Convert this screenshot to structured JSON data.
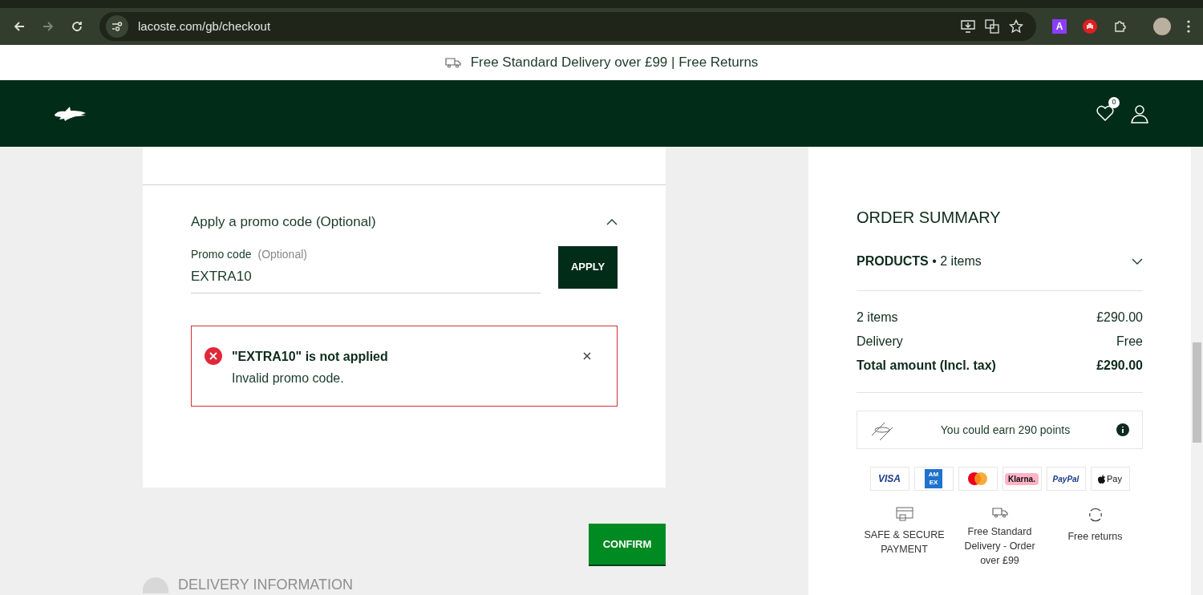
{
  "browser": {
    "url": "lacoste.com/gb/checkout",
    "extension_letter": "A"
  },
  "banner": {
    "text": "Free Standard Delivery over £99 | Free Returns"
  },
  "header": {
    "wishlist_count": "0"
  },
  "promo": {
    "title": "Apply a promo code (Optional)",
    "expanded": true,
    "label": "Promo code",
    "hint": "(Optional)",
    "value": "EXTRA10",
    "apply": "APPLY",
    "error": {
      "title": "\"EXTRA10\" is not applied",
      "message": "Invalid promo code."
    }
  },
  "confirm": "CONFIRM",
  "next_step": {
    "label": "DELIVERY INFORMATION"
  },
  "summary": {
    "title": "ORDER SUMMARY",
    "products_label": "PRODUCTS",
    "separator": "•",
    "products_count": "2 items",
    "products_expanded": false,
    "rows": [
      {
        "label": "2 items",
        "value": "£290.00",
        "bold": false
      },
      {
        "label": "Delivery",
        "value": "Free",
        "bold": false
      },
      {
        "label": "Total amount (Incl. tax)",
        "value": "£290.00",
        "bold": true
      }
    ],
    "loyalty": "You could earn 290 points",
    "payment_methods": [
      {
        "kind": "visa",
        "label": "VISA"
      },
      {
        "kind": "amex",
        "label": "AM EX"
      },
      {
        "kind": "mastercard"
      },
      {
        "kind": "klarna",
        "label": "Klarna."
      },
      {
        "kind": "paypal",
        "label": "PayPal"
      },
      {
        "kind": "applepay",
        "label": "Pay"
      }
    ],
    "features": [
      {
        "kind": "secure",
        "text": "SAFE & SECURE PAYMENT"
      },
      {
        "kind": "delivery",
        "text": "Free Standard Delivery - Order over £99"
      },
      {
        "kind": "returns",
        "text": "Free returns"
      }
    ]
  }
}
